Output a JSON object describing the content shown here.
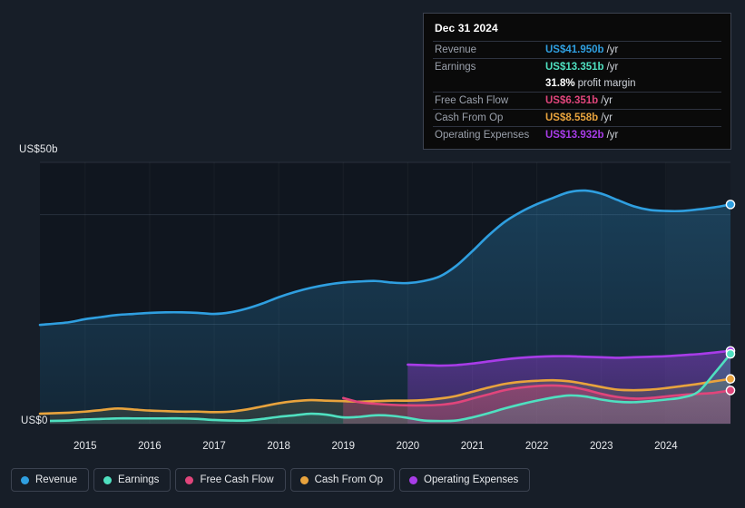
{
  "colors": {
    "background": "#171e28",
    "revenue": "#2f9fe0",
    "earnings": "#4fe0c0",
    "free_cash_flow": "#e0457b",
    "cash_from_op": "#e8a33d",
    "operating_expenses": "#a83ce8",
    "grid": "#2c3440",
    "tooltip_bg": "#0a0a0a",
    "tooltip_border": "#3c4250"
  },
  "tooltip": {
    "date": "Dec 31 2024",
    "rows": [
      {
        "label": "Revenue",
        "value": "US$41.950b",
        "unit": "/yr",
        "color": "#2f9fe0"
      },
      {
        "label": "Earnings",
        "value": "US$13.351b",
        "unit": "/yr",
        "color": "#4fe0c0"
      },
      {
        "label": "",
        "value": "31.8%",
        "unit": "profit margin",
        "color": "#ffffff"
      },
      {
        "label": "Free Cash Flow",
        "value": "US$6.351b",
        "unit": "/yr",
        "color": "#e0457b"
      },
      {
        "label": "Cash From Op",
        "value": "US$8.558b",
        "unit": "/yr",
        "color": "#e8a33d"
      },
      {
        "label": "Operating Expenses",
        "value": "US$13.932b",
        "unit": "/yr",
        "color": "#a83ce8"
      }
    ]
  },
  "legend": [
    {
      "label": "Revenue",
      "color": "#2f9fe0"
    },
    {
      "label": "Earnings",
      "color": "#4fe0c0"
    },
    {
      "label": "Free Cash Flow",
      "color": "#e0457b"
    },
    {
      "label": "Cash From Op",
      "color": "#e8a33d"
    },
    {
      "label": "Operating Expenses",
      "color": "#a83ce8"
    }
  ],
  "axis": {
    "y_top_label": "US$50b",
    "y_zero_label": "US$0",
    "x_ticks": [
      "2015",
      "2016",
      "2017",
      "2018",
      "2019",
      "2020",
      "2021",
      "2022",
      "2023",
      "2024"
    ]
  },
  "chart_data": {
    "type": "area",
    "title": "",
    "xlabel": "",
    "ylabel": "US$ billions",
    "ylim": [
      0,
      50
    ],
    "grid": true,
    "legend_position": "bottom",
    "x": [
      2014.3,
      2014.75,
      2015.0,
      2015.25,
      2015.5,
      2015.75,
      2016.0,
      2016.25,
      2016.5,
      2016.75,
      2017.0,
      2017.25,
      2017.5,
      2017.75,
      2018.0,
      2018.25,
      2018.5,
      2018.75,
      2019.0,
      2019.25,
      2019.5,
      2019.75,
      2020.0,
      2020.25,
      2020.5,
      2020.75,
      2021.0,
      2021.25,
      2021.5,
      2021.75,
      2022.0,
      2022.25,
      2022.5,
      2022.75,
      2023.0,
      2023.25,
      2023.5,
      2023.75,
      2024.0,
      2024.25,
      2024.5,
      2024.75,
      2025.0
    ],
    "series": [
      {
        "name": "Revenue",
        "color": "#2f9fe0",
        "values": [
          18.9,
          19.4,
          20.0,
          20.4,
          20.8,
          21.0,
          21.2,
          21.3,
          21.3,
          21.2,
          21.0,
          21.3,
          22.0,
          23.0,
          24.2,
          25.2,
          26.0,
          26.6,
          27.0,
          27.2,
          27.3,
          27.0,
          26.9,
          27.3,
          28.2,
          30.2,
          33.0,
          36.0,
          38.6,
          40.5,
          42.0,
          43.2,
          44.3,
          44.6,
          44.0,
          42.8,
          41.6,
          40.9,
          40.7,
          40.7,
          41.0,
          41.4,
          41.95
        ]
      },
      {
        "name": "Earnings",
        "color": "#4fe0c0",
        "values": [
          0.5,
          0.6,
          0.8,
          0.9,
          1.0,
          1.0,
          1.0,
          1.0,
          1.0,
          0.9,
          0.7,
          0.6,
          0.6,
          0.9,
          1.3,
          1.6,
          1.9,
          1.7,
          1.2,
          1.3,
          1.6,
          1.5,
          1.1,
          0.6,
          0.5,
          0.6,
          1.2,
          2.0,
          2.9,
          3.7,
          4.4,
          5.0,
          5.4,
          5.2,
          4.6,
          4.2,
          4.1,
          4.3,
          4.6,
          5.0,
          6.1,
          9.6,
          13.351
        ]
      },
      {
        "name": "Free Cash Flow",
        "color": "#e0457b",
        "values": [
          null,
          null,
          null,
          null,
          null,
          null,
          null,
          null,
          null,
          null,
          null,
          null,
          null,
          null,
          null,
          null,
          null,
          null,
          4.9,
          4.1,
          3.8,
          3.6,
          3.5,
          3.5,
          3.6,
          4.0,
          4.8,
          5.6,
          6.4,
          6.9,
          7.2,
          7.3,
          7.1,
          6.5,
          5.7,
          5.1,
          4.8,
          4.9,
          5.2,
          5.5,
          5.7,
          5.9,
          6.351
        ]
      },
      {
        "name": "Cash From Op",
        "color": "#e8a33d",
        "values": [
          1.9,
          2.1,
          2.3,
          2.6,
          2.9,
          2.7,
          2.5,
          2.4,
          2.3,
          2.3,
          2.2,
          2.3,
          2.7,
          3.3,
          3.9,
          4.3,
          4.5,
          4.4,
          4.3,
          4.2,
          4.3,
          4.4,
          4.4,
          4.5,
          4.8,
          5.3,
          6.1,
          6.9,
          7.6,
          8.0,
          8.2,
          8.3,
          8.1,
          7.6,
          7.0,
          6.5,
          6.4,
          6.5,
          6.8,
          7.2,
          7.6,
          8.1,
          8.558
        ]
      },
      {
        "name": "Operating Expenses",
        "color": "#a83ce8",
        "values": [
          null,
          null,
          null,
          null,
          null,
          null,
          null,
          null,
          null,
          null,
          null,
          null,
          null,
          null,
          null,
          null,
          null,
          null,
          null,
          null,
          null,
          null,
          11.3,
          11.2,
          11.1,
          11.2,
          11.5,
          11.9,
          12.3,
          12.6,
          12.8,
          12.9,
          12.9,
          12.8,
          12.7,
          12.6,
          12.7,
          12.8,
          12.9,
          13.1,
          13.3,
          13.6,
          13.932
        ]
      }
    ],
    "endpoint_markers": [
      {
        "name": "Revenue",
        "value": 41.95,
        "color": "#2f9fe0"
      },
      {
        "name": "Operating Expenses",
        "value": 13.932,
        "color": "#a83ce8"
      },
      {
        "name": "Earnings",
        "value": 13.351,
        "color": "#4fe0c0"
      },
      {
        "name": "Cash From Op",
        "value": 8.558,
        "color": "#e8a33d"
      },
      {
        "name": "Free Cash Flow",
        "value": 6.351,
        "color": "#e0457b"
      }
    ]
  }
}
